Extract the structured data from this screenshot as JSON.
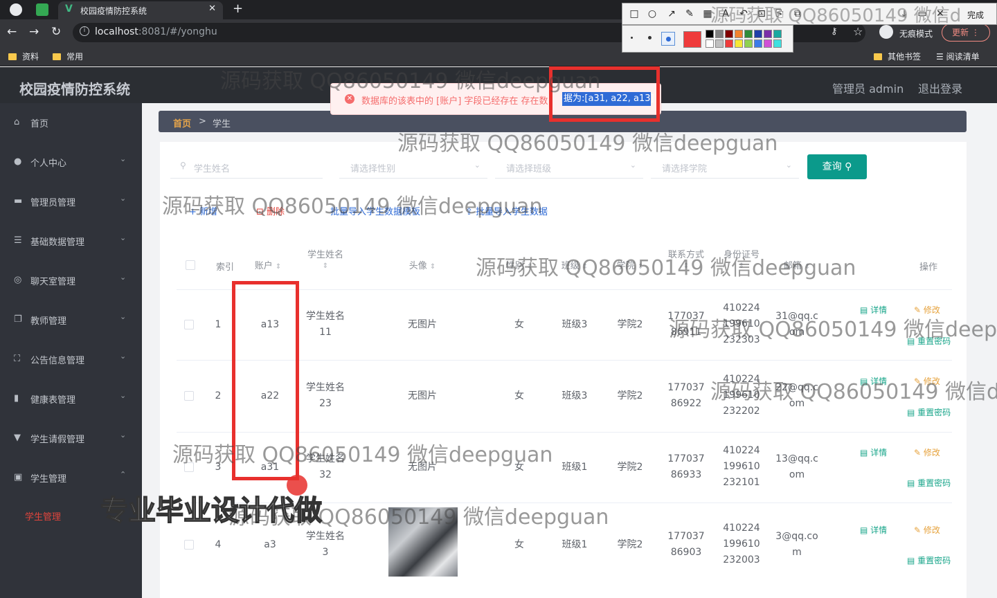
{
  "browser": {
    "tab_title": "校园疫情防控系统",
    "url_host": "localhost",
    "url_rest": ":8081/#/yonghu",
    "incognito_label": "无痕模式",
    "update_label": "更新",
    "bookmarks": [
      "资料",
      "常用"
    ],
    "other_bookmarks": "其他书签",
    "reading_list": "阅读清单"
  },
  "shot_tool": {
    "done_label": "完成"
  },
  "app": {
    "title": "校园疫情防控系统",
    "admin_label": "管理员 admin",
    "logout_label": "退出登录"
  },
  "sidebar": {
    "items": [
      {
        "label": "首页",
        "icon": "home-icon"
      },
      {
        "label": "个人中心",
        "icon": "user-icon"
      },
      {
        "label": "管理员管理",
        "icon": "monitor-icon"
      },
      {
        "label": "基础数据管理",
        "icon": "list-icon"
      },
      {
        "label": "聊天室管理",
        "icon": "chat-icon"
      },
      {
        "label": "教师管理",
        "icon": "copy-icon"
      },
      {
        "label": "公告信息管理",
        "icon": "frame-icon"
      },
      {
        "label": "健康表管理",
        "icon": "bar-chart-icon"
      },
      {
        "label": "学生请假管理",
        "icon": "pin-icon"
      },
      {
        "label": "学生管理",
        "icon": "card-icon"
      }
    ],
    "active_sub": "学生管理"
  },
  "breadcrumb": {
    "home": "首页",
    "sep": ">",
    "current": "学生"
  },
  "filters": {
    "name_placeholder": "学生姓名",
    "gender_placeholder": "请选择性别",
    "class_placeholder": "请选择班级",
    "college_placeholder": "请选择学院",
    "search_label": "查询"
  },
  "actions": {
    "add": "+ 新增",
    "delete": "删除",
    "template": "批量导入学生数据模板",
    "import": "批量导入学生数据"
  },
  "table": {
    "headers": {
      "index": "索引",
      "account": "账户",
      "name": "学生姓名",
      "avatar": "头像",
      "gender": "性别",
      "class": "班级",
      "college": "学院",
      "phone": "联系方式",
      "idcard": "身份证号",
      "email": "邮箱",
      "ops": "操作"
    },
    "rows": [
      {
        "index": "1",
        "account": "a13",
        "name": "学生姓名11",
        "avatar": "无图片",
        "gender": "女",
        "class": "班级3",
        "college": "学院2",
        "phone": "17703786911",
        "idcard": "410224199610232303",
        "email": "31@qq.com"
      },
      {
        "index": "2",
        "account": "a22",
        "name": "学生姓名23",
        "avatar": "无图片",
        "gender": "女",
        "class": "班级3",
        "college": "学院2",
        "phone": "17703786922",
        "idcard": "410224199610232202",
        "email": "22@qq.com"
      },
      {
        "index": "3",
        "account": "a31",
        "name": "学生姓名32",
        "avatar": "无图片",
        "gender": "女",
        "class": "班级1",
        "college": "学院2",
        "phone": "17703786933",
        "idcard": "410224199610232101",
        "email": "13@qq.com"
      },
      {
        "index": "4",
        "account": "a3",
        "name": "学生姓名3",
        "avatar": "",
        "gender": "女",
        "class": "班级1",
        "college": "学院2",
        "phone": "17703786903",
        "idcard": "410224199610232003",
        "email": "3@qq.com"
      }
    ],
    "op_detail": "详情",
    "op_edit": "修改",
    "op_reset": "重置密码"
  },
  "toast": {
    "message": "数据库的该表中的 [账户] 字段已经存在 存在数",
    "highlight": "据为:[a31, a22, a13]"
  },
  "watermarks": {
    "text": "源码获取 QQ86050149 微信deepguan",
    "cut1": "源码获取 QQ86050149 微信deep",
    "cut2": "源码获取 QQ86050149 微信d",
    "big": "专业毕业设计代做"
  }
}
